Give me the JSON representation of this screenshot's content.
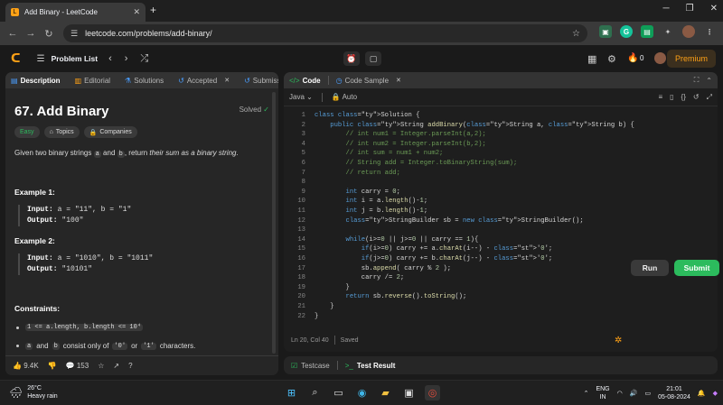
{
  "browser": {
    "tab_title": "Add Binary - LeetCode",
    "url": "leetcode.com/problems/add-binary/"
  },
  "header": {
    "problem_list": "Problem List",
    "streak": "0",
    "premium": "Premium"
  },
  "left": {
    "tabs": [
      "Description",
      "Editorial",
      "Solutions",
      "Accepted",
      "Submission"
    ],
    "title": "67. Add Binary",
    "solved": "Solved",
    "chips": [
      "Easy",
      "Topics",
      "Companies"
    ],
    "desc_pre": "Given two binary strings",
    "desc_a": "a",
    "desc_and": "and",
    "desc_b": "b",
    "desc_post": ", return",
    "desc_em": "their sum as a binary string",
    "desc_end": ".",
    "example1_h": "Example 1:",
    "example1_in_label": "Input:",
    "example1_in": "a = \"11\", b = \"1\"",
    "example1_out_label": "Output:",
    "example1_out": "\"100\"",
    "example2_h": "Example 2:",
    "example2_in_label": "Input:",
    "example2_in": "a = \"1010\", b = \"1011\"",
    "example2_out_label": "Output:",
    "example2_out": "\"10101\"",
    "constraints_h": "Constraints:",
    "c1": "1 <= a.length, b.length <= 10⁴",
    "c2_a": "a",
    "c2_and": "and",
    "c2_b": "b",
    "c2_text": "consist only of",
    "c2_0": "'0'",
    "c2_or": "or",
    "c2_1": "'1'",
    "c2_end": "characters.",
    "likes": "9.4K",
    "comments": "153"
  },
  "right": {
    "tabs": [
      "Code",
      "Code Sample"
    ],
    "language": "Java",
    "auto": "Auto",
    "status": "Ln 20, Col 40",
    "saved": "Saved",
    "run": "Run",
    "submit": "Submit",
    "test_tabs": [
      "Testcase",
      "Test Result"
    ]
  },
  "code_lines": [
    "class Solution {",
    "    public String addBinary(String a, String b) {",
    "        // int num1 = Integer.parseInt(a,2);",
    "        // int num2 = Integer.parseInt(b,2);",
    "        // int sum = num1 + num2;",
    "        // String add = Integer.toBinaryString(sum);",
    "        // return add;",
    "",
    "        int carry = 0;",
    "        int i = a.length()-1;",
    "        int j = b.length()-1;",
    "        StringBuilder sb = new StringBuilder();",
    "",
    "        while(i>=0 || j>=0 || carry == 1){",
    "            if(i>=0) carry += a.charAt(i--) - '0';",
    "            if(j>=0) carry += b.charAt(j--) - '0';",
    "            sb.append( carry % 2 );",
    "            carry /= 2;",
    "        }",
    "        return sb.reverse().toString();",
    "    }",
    "}"
  ],
  "taskbar": {
    "temp": "26°C",
    "weather": "Heavy rain",
    "lang1": "ENG",
    "lang2": "IN",
    "time": "21:01",
    "date": "05-08-2024"
  }
}
